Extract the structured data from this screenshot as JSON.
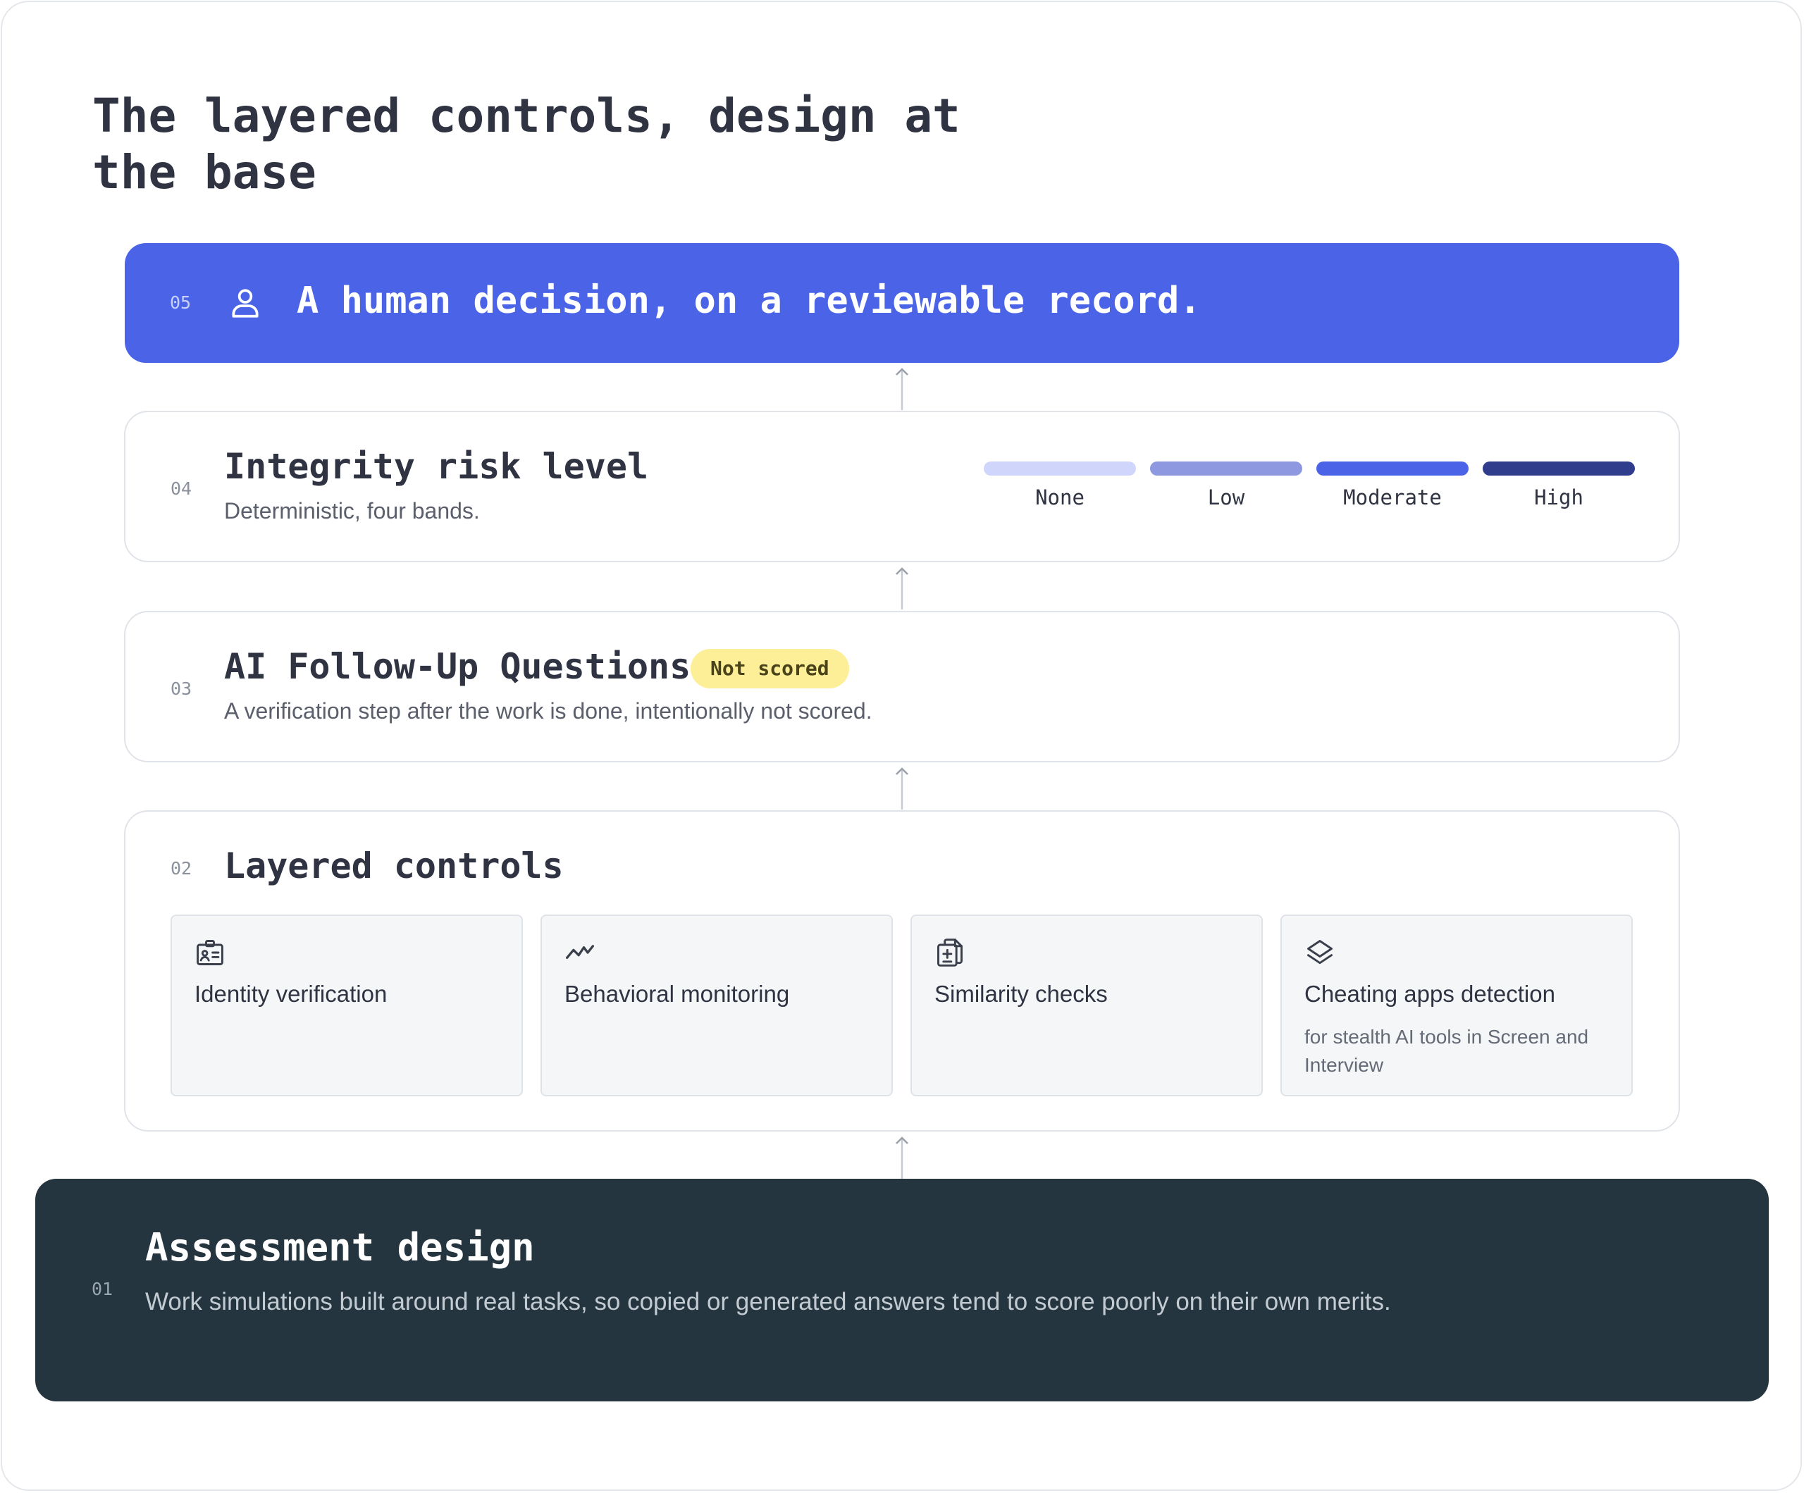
{
  "title": "The layered controls, design at the base",
  "layers": {
    "decision": {
      "number": "05",
      "icon": "person-icon",
      "title": "A human decision, on a reviewable record."
    },
    "risk": {
      "number": "04",
      "title": "Integrity risk level",
      "description": "Deterministic, four bands.",
      "bands": [
        {
          "label": "None",
          "color": "#d0d6fb"
        },
        {
          "label": "Low",
          "color": "#8d98e0"
        },
        {
          "label": "Moderate",
          "color": "#4a63e7"
        },
        {
          "label": "High",
          "color": "#2f3d8c"
        }
      ]
    },
    "followup": {
      "number": "03",
      "title": "AI Follow-Up Questions",
      "badge": "Not scored",
      "description": "A verification step after the work is done, intentionally not scored."
    },
    "controls": {
      "number": "02",
      "title": "Layered controls",
      "cards": [
        {
          "icon": "id-card-icon",
          "label": "Identity verification",
          "sublabel": ""
        },
        {
          "icon": "activity-icon",
          "label": "Behavioral monitoring",
          "sublabel": ""
        },
        {
          "icon": "documents-icon",
          "label": "Similarity checks",
          "sublabel": ""
        },
        {
          "icon": "layers-icon",
          "label": "Cheating apps detection",
          "sublabel": "for stealth AI tools in Screen and Interview"
        }
      ]
    },
    "design": {
      "number": "01",
      "title": "Assessment design",
      "description": "Work simulations built around real tasks, so copied or generated answers tend to score poorly on their own merits."
    }
  },
  "colors": {
    "accent": "#4a63e7",
    "dark": "#253540",
    "badge": "#fdef97"
  }
}
